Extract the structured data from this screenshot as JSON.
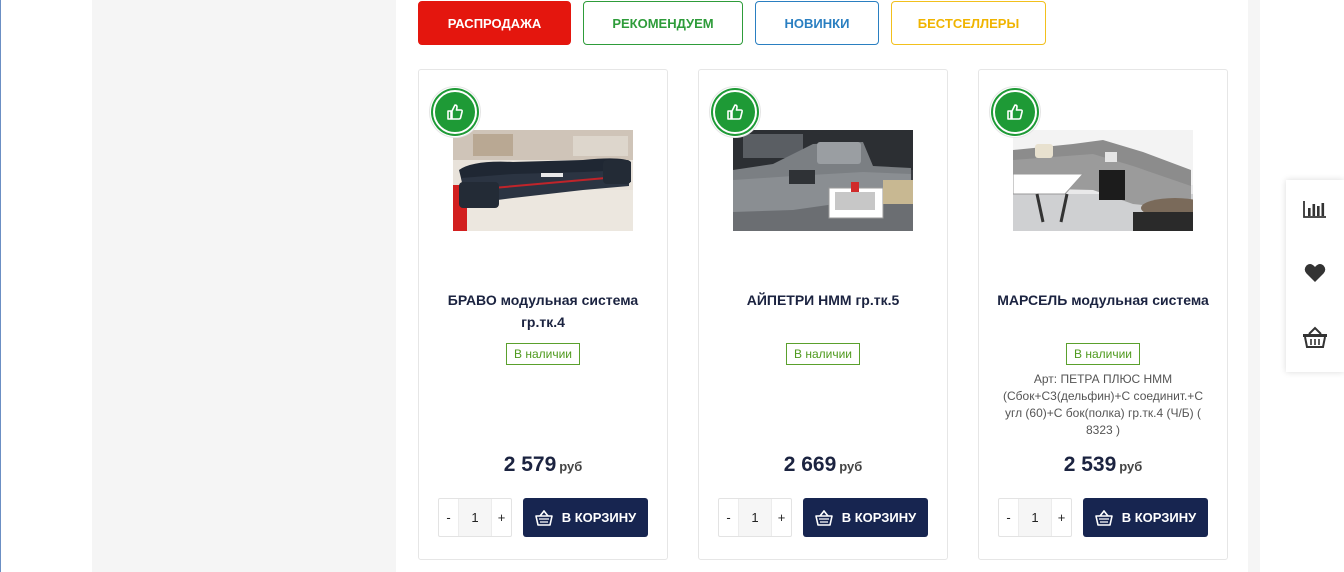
{
  "tabs": [
    {
      "label": "РАСПРОДАЖА"
    },
    {
      "label": "РЕКОМЕНДУЕМ"
    },
    {
      "label": "НОВИНКИ"
    },
    {
      "label": "БЕСТСЕЛЛЕРЫ"
    }
  ],
  "products": [
    {
      "title": "БРАВО модульная система гр.тк.4",
      "stock": "В наличии",
      "article": "",
      "price": "2 579",
      "currency": "руб",
      "qty_minus": "-",
      "qty": "1",
      "qty_plus": "+",
      "cart_label": "В КОРЗИНУ",
      "badge_icon": "thumbs-up-icon"
    },
    {
      "title": "АЙПЕТРИ НММ гр.тк.5",
      "stock": "В наличии",
      "article": "",
      "price": "2 669",
      "currency": "руб",
      "qty_minus": "-",
      "qty": "1",
      "qty_plus": "+",
      "cart_label": "В КОРЗИНУ",
      "badge_icon": "thumbs-up-icon"
    },
    {
      "title": "МАРСЕЛЬ модульная система",
      "stock": "В наличии",
      "article": "Арт: ПЕТРА ПЛЮС НММ (Сбок+С3(дельфин)+С соединит.+С угл (60)+С бок(полка) гр.тк.4 (Ч/Б) ( 8323 )",
      "price": "2 539",
      "currency": "руб",
      "qty_minus": "-",
      "qty": "1",
      "qty_plus": "+",
      "cart_label": "В КОРЗИНУ",
      "badge_icon": "thumbs-up-icon"
    }
  ],
  "side_widget": {
    "icons": [
      "compare-chart-icon",
      "heart-icon",
      "basket-icon"
    ]
  },
  "colors": {
    "sale": "#e4160e",
    "recommend": "#2e9c3a",
    "new": "#2a7fc1",
    "bestseller": "#f0b400",
    "cart_button": "#172550",
    "badge": "#1e9a36",
    "in_stock": "#4f9a1e"
  }
}
